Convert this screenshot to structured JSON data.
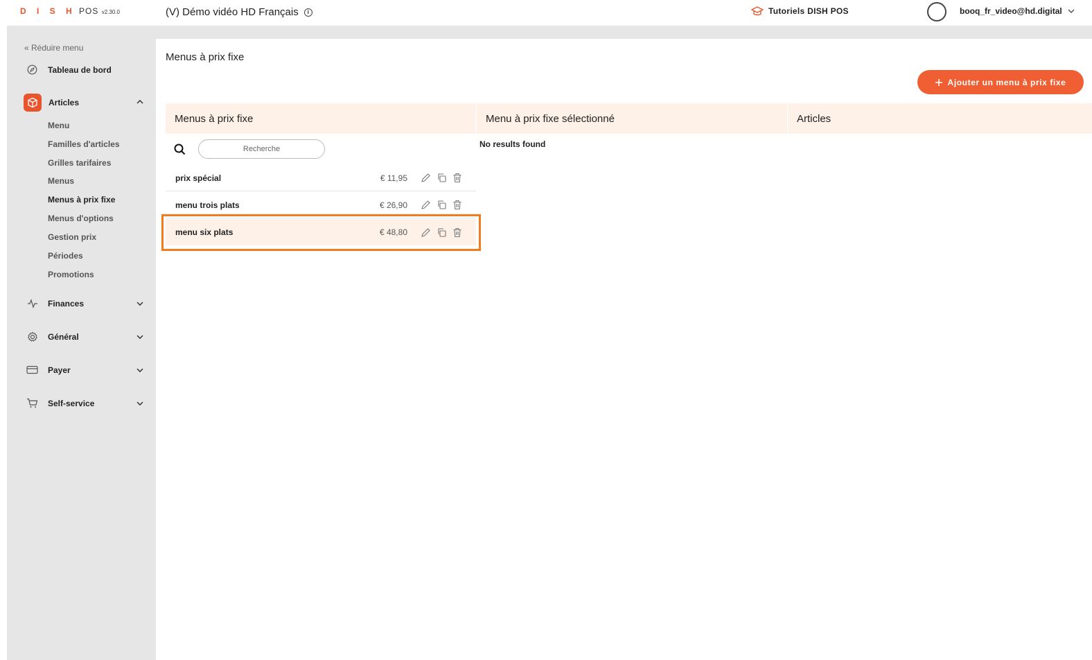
{
  "header": {
    "logo_dish": "D I S H",
    "logo_pos": "POS",
    "version": "v2.30.0",
    "venue": "(V) Démo vidéo HD Français",
    "tutorials": "Tutoriels DISH POS",
    "user_email": "booq_fr_video@hd.digital"
  },
  "sidebar": {
    "collapse_label": "Réduire menu",
    "dashboard": "Tableau de bord",
    "articles": "Articles",
    "articles_items": [
      "Menu",
      "Familles d'articles",
      "Grilles tarifaires",
      "Menus",
      "Menus à prix fixe",
      "Menus d'options",
      "Gestion prix",
      "Périodes",
      "Promotions"
    ],
    "finances": "Finances",
    "general": "Général",
    "payer": "Payer",
    "selfservice": "Self-service"
  },
  "main": {
    "title": "Menus à prix fixe",
    "add_button": "Ajouter un menu à prix fixe",
    "columns": [
      "Menus à prix fixe",
      "Menu à prix fixe sélectionné",
      "Articles"
    ],
    "search_placeholder": "Recherche",
    "no_results": "No results found",
    "rows": [
      {
        "name": "prix spécial",
        "price": "€ 11,95"
      },
      {
        "name": "menu trois plats",
        "price": "€ 26,90"
      },
      {
        "name": "menu six plats",
        "price": "€ 48,80"
      }
    ]
  },
  "colors": {
    "accent": "#ef5f33",
    "header_bg": "#fdf1e8",
    "highlight": "#f27b1d"
  }
}
